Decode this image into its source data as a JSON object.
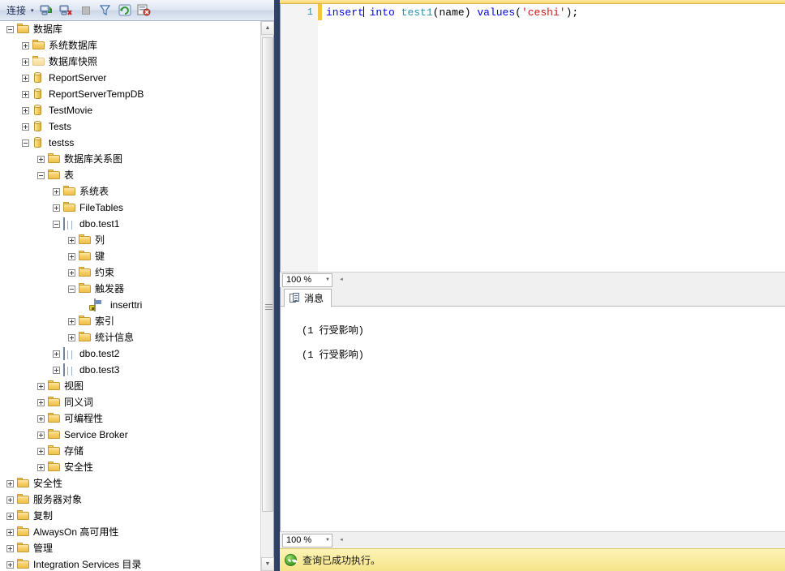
{
  "object_explorer": {
    "toolbar": {
      "connect_label": "连接",
      "caret": "▾",
      "buttons": [
        {
          "name": "connect-server-icon",
          "title": "连接"
        },
        {
          "name": "disconnect-server-icon",
          "title": "断开连接"
        },
        {
          "name": "stop-icon",
          "title": "停止"
        },
        {
          "name": "filter-icon",
          "title": "筛选器"
        },
        {
          "name": "refresh-icon",
          "title": "刷新"
        },
        {
          "name": "report-icon",
          "title": "报表"
        }
      ]
    },
    "tree": [
      {
        "label": "数据库",
        "indent": 1,
        "state": "minus",
        "icon": "folder"
      },
      {
        "label": "系统数据库",
        "indent": 2,
        "state": "plus",
        "icon": "folder"
      },
      {
        "label": "数据库快照",
        "indent": 2,
        "state": "plus",
        "icon": "folder-ghost"
      },
      {
        "label": "ReportServer",
        "indent": 2,
        "state": "plus",
        "icon": "database"
      },
      {
        "label": "ReportServerTempDB",
        "indent": 2,
        "state": "plus",
        "icon": "database"
      },
      {
        "label": "TestMovie",
        "indent": 2,
        "state": "plus",
        "icon": "database"
      },
      {
        "label": "Tests",
        "indent": 2,
        "state": "plus",
        "icon": "database"
      },
      {
        "label": "testss",
        "indent": 2,
        "state": "minus",
        "icon": "database"
      },
      {
        "label": "数据库关系图",
        "indent": 3,
        "state": "plus",
        "icon": "folder"
      },
      {
        "label": "表",
        "indent": 3,
        "state": "minus",
        "icon": "folder"
      },
      {
        "label": "系统表",
        "indent": 4,
        "state": "plus",
        "icon": "folder"
      },
      {
        "label": "FileTables",
        "indent": 4,
        "state": "plus",
        "icon": "folder"
      },
      {
        "label": "dbo.test1",
        "indent": 4,
        "state": "minus",
        "icon": "table"
      },
      {
        "label": "列",
        "indent": 5,
        "state": "plus",
        "icon": "folder"
      },
      {
        "label": "键",
        "indent": 5,
        "state": "plus",
        "icon": "folder"
      },
      {
        "label": "约束",
        "indent": 5,
        "state": "plus",
        "icon": "folder"
      },
      {
        "label": "触发器",
        "indent": 5,
        "state": "minus",
        "icon": "folder"
      },
      {
        "label": "inserttri",
        "indent": 6,
        "state": "none",
        "icon": "trigger"
      },
      {
        "label": "索引",
        "indent": 5,
        "state": "plus",
        "icon": "folder"
      },
      {
        "label": "统计信息",
        "indent": 5,
        "state": "plus",
        "icon": "folder"
      },
      {
        "label": "dbo.test2",
        "indent": 4,
        "state": "plus",
        "icon": "table"
      },
      {
        "label": "dbo.test3",
        "indent": 4,
        "state": "plus",
        "icon": "table"
      },
      {
        "label": "视图",
        "indent": 3,
        "state": "plus",
        "icon": "folder"
      },
      {
        "label": "同义词",
        "indent": 3,
        "state": "plus",
        "icon": "folder"
      },
      {
        "label": "可编程性",
        "indent": 3,
        "state": "plus",
        "icon": "folder"
      },
      {
        "label": "Service Broker",
        "indent": 3,
        "state": "plus",
        "icon": "folder"
      },
      {
        "label": "存储",
        "indent": 3,
        "state": "plus",
        "icon": "folder"
      },
      {
        "label": "安全性",
        "indent": 3,
        "state": "plus",
        "icon": "folder"
      },
      {
        "label": "安全性",
        "indent": 1,
        "state": "plus",
        "icon": "folder"
      },
      {
        "label": "服务器对象",
        "indent": 1,
        "state": "plus",
        "icon": "folder"
      },
      {
        "label": "复制",
        "indent": 1,
        "state": "plus",
        "icon": "folder"
      },
      {
        "label": "AlwaysOn 高可用性",
        "indent": 1,
        "state": "plus",
        "icon": "folder"
      },
      {
        "label": "管理",
        "indent": 1,
        "state": "plus",
        "icon": "folder"
      },
      {
        "label": "Integration Services 目录",
        "indent": 1,
        "state": "plus",
        "icon": "folder"
      }
    ]
  },
  "editor": {
    "line_number": "1",
    "code_tokens": [
      {
        "text": "insert",
        "type": "kw"
      },
      {
        "text": " ",
        "type": "punct"
      },
      {
        "text": "into",
        "type": "kw"
      },
      {
        "text": " ",
        "type": "punct"
      },
      {
        "text": "test1",
        "type": "ident"
      },
      {
        "text": "(",
        "type": "punct"
      },
      {
        "text": "name",
        "type": "punct"
      },
      {
        "text": ")",
        "type": "punct"
      },
      {
        "text": " ",
        "type": "punct"
      },
      {
        "text": "values",
        "type": "kw"
      },
      {
        "text": "(",
        "type": "punct"
      },
      {
        "text": "'ceshi'",
        "type": "str"
      },
      {
        "text": ");",
        "type": "punct"
      }
    ],
    "caret_after_token_index": 0,
    "zoom_label": "100 %"
  },
  "results": {
    "tab_label": "消息",
    "messages": [
      "(1 行受影响)",
      "(1 行受影响)"
    ],
    "zoom_label": "100 %"
  },
  "status": {
    "text": "查询已成功执行。"
  },
  "colors": {
    "keyword": "#0000ff",
    "identifier": "#2b91af",
    "string": "#c41a16",
    "status_bg": "#f4e489",
    "divider": "#32466b",
    "change_marker": "#f2c63c"
  }
}
